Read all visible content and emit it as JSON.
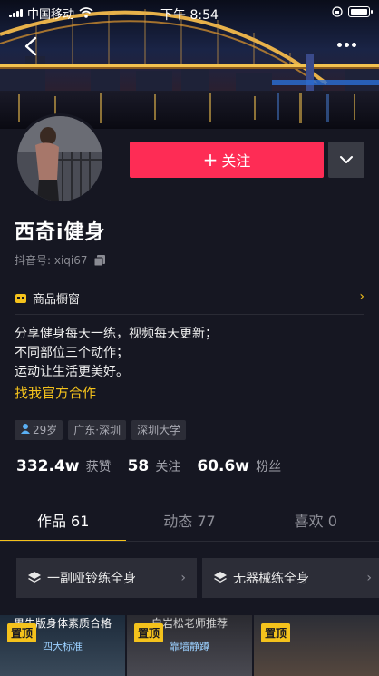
{
  "status_bar": {
    "carrier": "中国移动",
    "time": "下午 8:54"
  },
  "profile": {
    "nickname": "西奇i健身",
    "douyin_id": "抖音号: xiqi67",
    "follow_label": "关注",
    "shop_label": "商品橱窗",
    "bio_lines": [
      "分享健身每天一练，视频每天更新；",
      "不同部位三个动作；",
      "运动让生活更美好。"
    ],
    "cooperate_link": "找我官方合作",
    "tags": {
      "age": "29岁",
      "location": "广东·深圳",
      "school": "深圳大学"
    },
    "stats": {
      "likes_num": "332.4w",
      "likes_label": "获赞",
      "following_num": "58",
      "following_label": "关注",
      "followers_num": "60.6w",
      "followers_label": "粉丝"
    }
  },
  "tabs": [
    {
      "label": "作品 61",
      "active": true
    },
    {
      "label": "动态 77",
      "active": false
    },
    {
      "label": "喜欢 0",
      "active": false
    }
  ],
  "collections": [
    {
      "label": "一副哑铃练全身"
    },
    {
      "label": "无器械练全身"
    }
  ],
  "videos": [
    {
      "pin": "置顶",
      "caption": "男生版身体素质合格",
      "caption2": "四大标准"
    },
    {
      "pin": "置顶",
      "caption": "白岩松老师推荐",
      "caption2": "靠墙静蹲"
    },
    {
      "pin": "置顶",
      "caption": "",
      "caption2": ""
    }
  ],
  "colors": {
    "accent_red": "#fe2c55",
    "accent_yellow": "#f4c21c",
    "background": "#161722"
  }
}
